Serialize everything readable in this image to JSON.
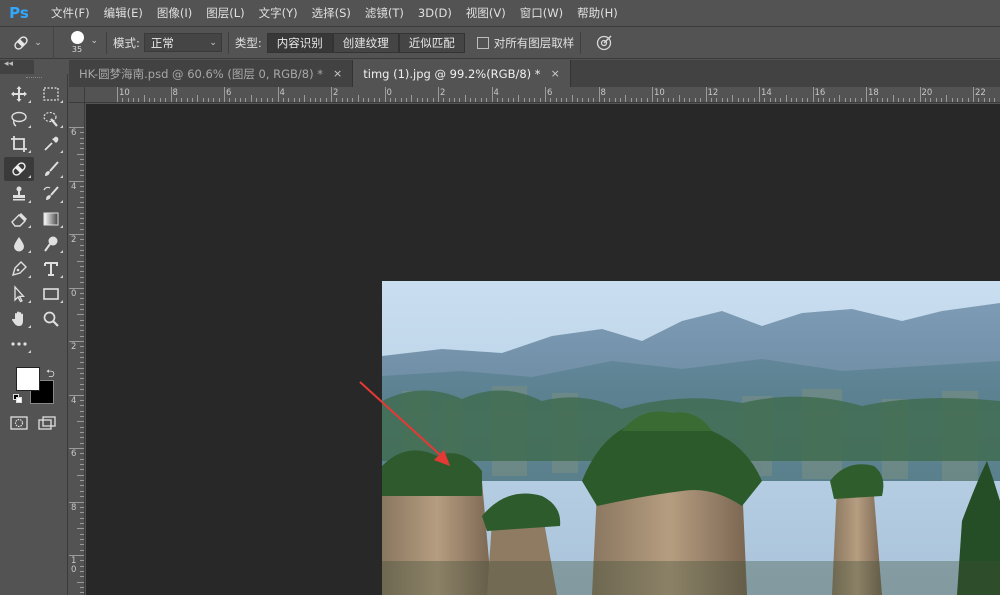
{
  "app": {
    "logo": "Ps",
    "brand_color": "#31a8ff"
  },
  "menu": [
    {
      "label": "文件(F)"
    },
    {
      "label": "编辑(E)"
    },
    {
      "label": "图像(I)"
    },
    {
      "label": "图层(L)"
    },
    {
      "label": "文字(Y)"
    },
    {
      "label": "选择(S)"
    },
    {
      "label": "滤镜(T)"
    },
    {
      "label": "3D(D)"
    },
    {
      "label": "视图(V)"
    },
    {
      "label": "窗口(W)"
    },
    {
      "label": "帮助(H)"
    }
  ],
  "options": {
    "tool_icon": "spot-healing-brush-icon",
    "brush_size": "35",
    "mode_label": "模式:",
    "mode_value": "正常",
    "type_label": "类型:",
    "type_buttons": [
      {
        "label": "内容识别",
        "active": true
      },
      {
        "label": "创建纹理",
        "active": false
      },
      {
        "label": "近似匹配",
        "active": false
      }
    ],
    "sample_all_layers_label": "对所有图层取样",
    "sample_all_layers_checked": false
  },
  "tabs": [
    {
      "label": "HK-圆梦海南.psd @ 60.6% (图层 0, RGB/8) *",
      "active": false
    },
    {
      "label": "timg (1).jpg @ 99.2%(RGB/8) *",
      "active": true
    }
  ],
  "tab_close_glyph": "×",
  "ruler_h_labels": [
    "10",
    "8",
    "6",
    "4",
    "2",
    "0",
    "2",
    "4",
    "6",
    "8",
    "10",
    "12",
    "14",
    "16",
    "18",
    "20",
    "22"
  ],
  "ruler_v_labels": [
    "6",
    "4",
    "2",
    "0",
    "2",
    "4",
    "6",
    "8",
    "10"
  ],
  "colors": {
    "foreground": "#ffffff",
    "background": "#000000",
    "annotation_arrow": "#e53935"
  }
}
